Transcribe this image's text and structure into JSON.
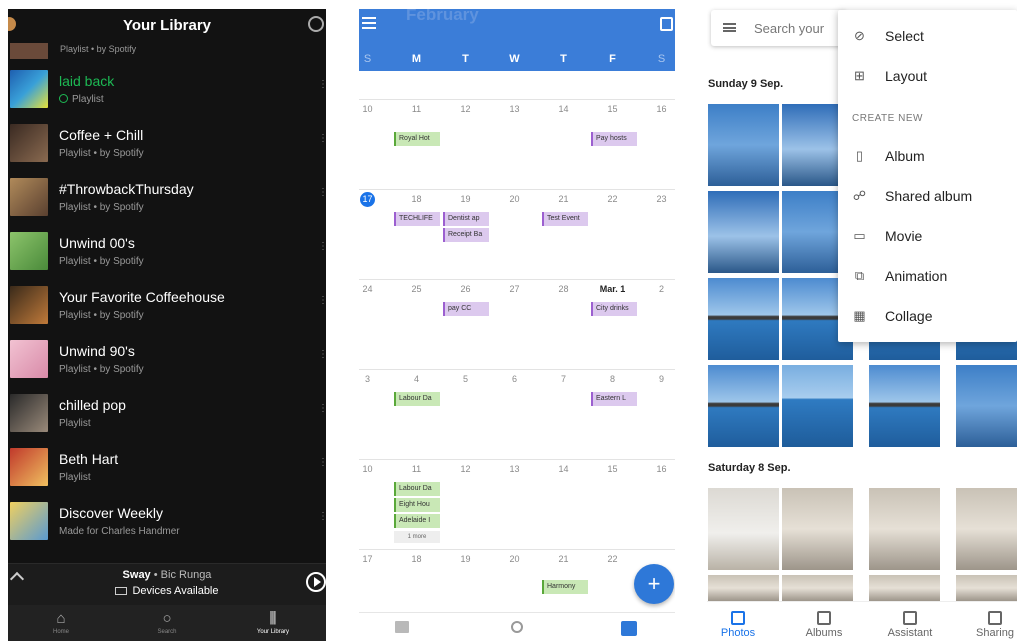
{
  "spotify": {
    "title": "Your Library",
    "partial_row_sub": "Playlist • by Spotify",
    "items": [
      {
        "name": "laid back",
        "sub": "Playlist",
        "highlight": true,
        "color": "#1e5fb0"
      },
      {
        "name": "Coffee + Chill",
        "sub": "Playlist • by Spotify",
        "color": "#6b4a38"
      },
      {
        "name": "#ThrowbackThursday",
        "sub": "Playlist • by Spotify",
        "color": "#8a6a4a"
      },
      {
        "name": "Unwind 00's",
        "sub": "Playlist • by Spotify",
        "color": "#6aa84f"
      },
      {
        "name": "Your Favorite Coffeehouse",
        "sub": "Playlist • by Spotify",
        "color": "#7a5230"
      },
      {
        "name": "Unwind 90's",
        "sub": "Playlist • by Spotify",
        "color": "#e8a9c0"
      },
      {
        "name": "chilled pop",
        "sub": "Playlist",
        "color": "#4a3a3a"
      },
      {
        "name": "Beth Hart",
        "sub": "Playlist",
        "color": "#a33a2a"
      },
      {
        "name": "Discover Weekly",
        "sub": "Made for Charles Handmer",
        "color": "#d9b34a"
      }
    ],
    "player": {
      "track": "Sway",
      "artist": "Bic Runga",
      "devices": "Devices Available"
    },
    "nav": [
      {
        "label": "Home",
        "icon": "home-icon"
      },
      {
        "label": "Search",
        "icon": "search-icon"
      },
      {
        "label": "Your Library",
        "icon": "library-icon"
      }
    ]
  },
  "calendar": {
    "month": "February",
    "dow": [
      "S",
      "M",
      "T",
      "W",
      "T",
      "F",
      "S"
    ],
    "weeks": [
      {
        "days": [
          "10",
          "11",
          "12",
          "13",
          "14",
          "15",
          "16"
        ]
      },
      {
        "days": [
          "17",
          "18",
          "19",
          "20",
          "21",
          "22",
          "23"
        ]
      },
      {
        "days": [
          "24",
          "25",
          "26",
          "27",
          "28",
          "Mar. 1",
          "2"
        ]
      },
      {
        "days": [
          "3",
          "4",
          "5",
          "6",
          "7",
          "8",
          "9"
        ]
      },
      {
        "days": [
          "10",
          "11",
          "12",
          "13",
          "14",
          "15",
          "16"
        ]
      },
      {
        "days": [
          "17",
          "18",
          "19",
          "20",
          "21",
          "22",
          ""
        ]
      }
    ],
    "events": {
      "e1": "Royal Hot",
      "e2": "Pay hosts",
      "e3": "TECHLIFE",
      "e4": "Dentist ap",
      "e5": "Receipt Ba",
      "e6": "Test Event",
      "e7": "pay CC",
      "e8": "City drinks",
      "e9": "Labour Da",
      "e10": "Eastern L",
      "e11": "Labour Da",
      "e12": "Eight Hou",
      "e13": "Adelaide I",
      "e14": "Harmony"
    },
    "more": "1 more",
    "fab": "+"
  },
  "photos": {
    "search_placeholder": "Search your",
    "menu": {
      "select": "Select",
      "layout": "Layout",
      "create_new": "CREATE NEW",
      "album": "Album",
      "shared_album": "Shared album",
      "movie": "Movie",
      "animation": "Animation",
      "collage": "Collage"
    },
    "date1": "Sunday 9 Sep.",
    "date2": "Saturday 8 Sep.",
    "nav": [
      {
        "label": "Photos",
        "icon": "photos-icon"
      },
      {
        "label": "Albums",
        "icon": "albums-icon"
      },
      {
        "label": "Assistant",
        "icon": "assistant-icon"
      },
      {
        "label": "Sharing",
        "icon": "sharing-icon"
      }
    ]
  }
}
